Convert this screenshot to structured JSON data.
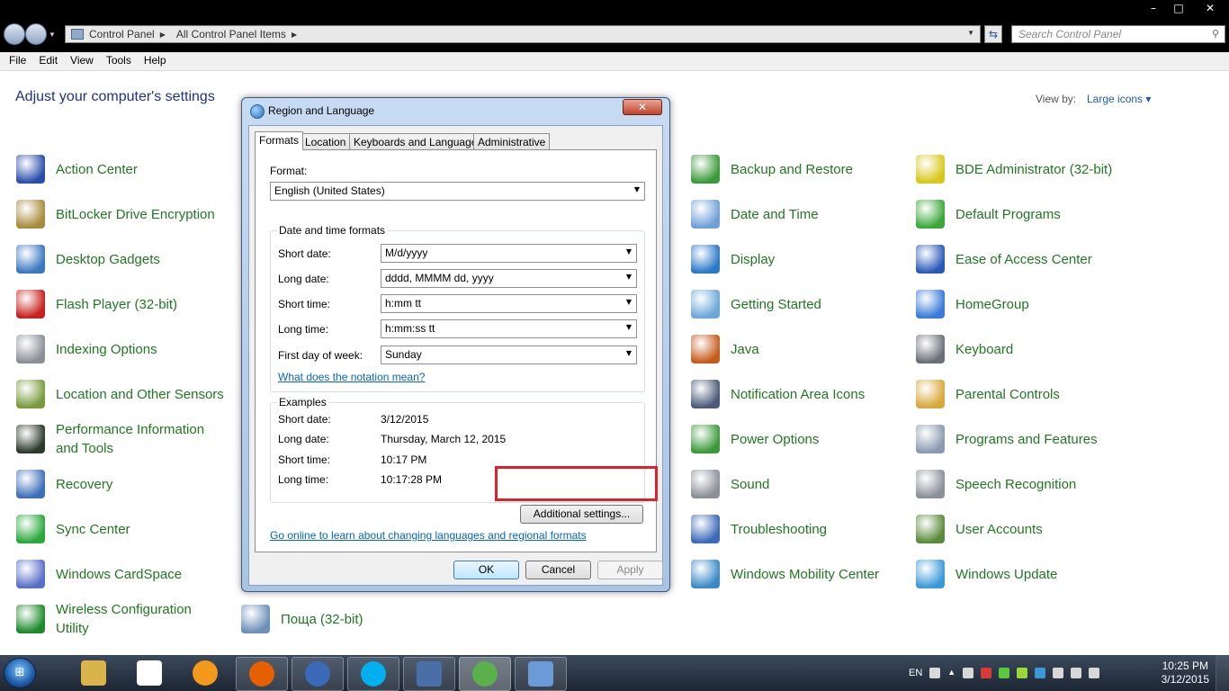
{
  "window": {
    "controls": [
      "–",
      "□",
      "✕"
    ],
    "address_crumbs": [
      "Control Panel",
      "All Control Panel Items"
    ],
    "search_placeholder": "Search Control Panel"
  },
  "menu": [
    "File",
    "Edit",
    "View",
    "Tools",
    "Help"
  ],
  "content": {
    "heading": "Adjust your computer's settings",
    "view_by_label": "View by:",
    "view_by_value": "Large icons ▾",
    "items": [
      {
        "label": "Action Center",
        "icon": "flag-icon",
        "color": "#2a4fa8"
      },
      {
        "label": "BitLocker Drive Encryption",
        "icon": "key-icon",
        "color": "#a88b3c"
      },
      {
        "label": "Desktop Gadgets",
        "icon": "gadgets-icon",
        "color": "#3a78c0"
      },
      {
        "label": "Flash Player (32-bit)",
        "icon": "flash-icon",
        "color": "#c8201c"
      },
      {
        "label": "Indexing Options",
        "icon": "magnifier-icon",
        "color": "#8a8f98"
      },
      {
        "label": "Location and Other Sensors",
        "icon": "sensor-icon",
        "color": "#7a9b3c"
      },
      {
        "label": "Performance Information and Tools",
        "icon": "performance-icon",
        "color": "#2b3a2b"
      },
      {
        "label": "Recovery",
        "icon": "recovery-icon",
        "color": "#3c6fb8"
      },
      {
        "label": "Sync Center",
        "icon": "sync-icon",
        "color": "#2aa83a"
      },
      {
        "label": "Windows CardSpace",
        "icon": "cardspace-icon",
        "color": "#5a6fc8"
      },
      {
        "label": "Wireless Configuration Utility",
        "icon": "wireless-icon",
        "color": "#1e8a2a"
      },
      {
        "label": "Поща (32-bit)",
        "icon": "mail-icon",
        "color": "#6a8fb8"
      },
      {
        "label": "Backup and Restore",
        "icon": "backup-icon",
        "color": "#3a9a3a"
      },
      {
        "label": "Date and Time",
        "icon": "calendar-icon",
        "color": "#6fa0d8"
      },
      {
        "label": "Display",
        "icon": "monitor-icon",
        "color": "#2a7ac8"
      },
      {
        "label": "Getting Started",
        "icon": "getting-started-icon",
        "color": "#6aa8d8"
      },
      {
        "label": "Java",
        "icon": "java-icon",
        "color": "#c85a1c"
      },
      {
        "label": "Notification Area Icons",
        "icon": "notification-icon",
        "color": "#4a5a78"
      },
      {
        "label": "Power Options",
        "icon": "power-icon",
        "color": "#3a9a3a"
      },
      {
        "label": "Sound",
        "icon": "speaker-icon",
        "color": "#8a8f98"
      },
      {
        "label": "Troubleshooting",
        "icon": "troubleshoot-icon",
        "color": "#3a6ab8"
      },
      {
        "label": "Windows Mobility Center",
        "icon": "mobility-icon",
        "color": "#3a8ac8"
      },
      {
        "label": "BDE Administrator (32-bit)",
        "icon": "bde-icon",
        "color": "#d8c81c"
      },
      {
        "label": "Default Programs",
        "icon": "default-programs-icon",
        "color": "#3aa83a"
      },
      {
        "label": "Ease of Access Center",
        "icon": "ease-of-access-icon",
        "color": "#2a5ab8"
      },
      {
        "label": "HomeGroup",
        "icon": "homegroup-icon",
        "color": "#3a7ad8"
      },
      {
        "label": "Keyboard",
        "icon": "keyboard-icon",
        "color": "#6a6f78"
      },
      {
        "label": "Parental Controls",
        "icon": "parental-icon",
        "color": "#d8a83a"
      },
      {
        "label": "Programs and Features",
        "icon": "programs-icon",
        "color": "#8a9ab0"
      },
      {
        "label": "Speech Recognition",
        "icon": "microphone-icon",
        "color": "#8a8f98"
      },
      {
        "label": "User Accounts",
        "icon": "users-icon",
        "color": "#5a8a3a"
      },
      {
        "label": "Windows Update",
        "icon": "windows-update-icon",
        "color": "#3a9ad8"
      }
    ]
  },
  "dialog": {
    "title": "Region and Language",
    "close": "✕",
    "tabs": [
      "Formats",
      "Location",
      "Keyboards and Languages",
      "Administrative"
    ],
    "format_label": "Format:",
    "format_value": "English (United States)",
    "dt_group_title": "Date and time formats",
    "rows": [
      {
        "label": "Short date:",
        "value": "M/d/yyyy"
      },
      {
        "label": "Long date:",
        "value": "dddd, MMMM dd, yyyy"
      },
      {
        "label": "Short time:",
        "value": "h:mm tt"
      },
      {
        "label": "Long time:",
        "value": "h:mm:ss tt"
      },
      {
        "label": "First day of week:",
        "value": "Sunday"
      }
    ],
    "notation_link": "What does the notation mean?",
    "examples_title": "Examples",
    "examples": [
      {
        "label": "Short date:",
        "value": "3/12/2015"
      },
      {
        "label": "Long date:",
        "value": "Thursday, March 12, 2015"
      },
      {
        "label": "Short time:",
        "value": "10:17 PM"
      },
      {
        "label": "Long time:",
        "value": "10:17:28 PM"
      }
    ],
    "additional_button": "Additional settings...",
    "online_link": "Go online to learn about changing languages and regional formats",
    "ok": "OK",
    "cancel": "Cancel",
    "apply": "Apply",
    "highlight_color": "#e0202a"
  },
  "taskbar": {
    "start_glyph": "⊞",
    "apps": [
      "explorer-icon",
      "notepad-icon",
      "orange-app-icon",
      "firefox-icon",
      "thunderbird-icon",
      "skype-icon",
      "remote-desktop-icon",
      "region-language-icon",
      "control-panel-icon"
    ],
    "language": "EN",
    "time": "10:25 PM",
    "date": "3/12/2015"
  }
}
